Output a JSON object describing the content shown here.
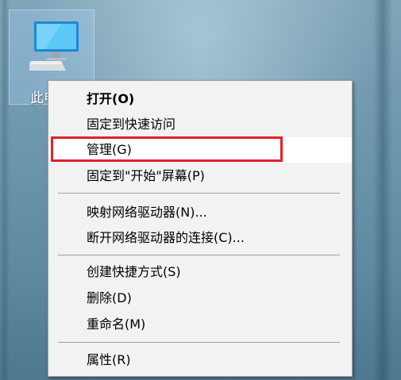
{
  "desktop": {
    "icon_label": "此电"
  },
  "context_menu": {
    "items": [
      {
        "label": "打开(O)"
      },
      {
        "label": "固定到快速访问"
      },
      {
        "label": "管理(G)"
      },
      {
        "label": "固定到\"开始\"屏幕(P)"
      },
      {
        "label": "映射网络驱动器(N)..."
      },
      {
        "label": "断开网络驱动器的连接(C)..."
      },
      {
        "label": "创建快捷方式(S)"
      },
      {
        "label": "删除(D)"
      },
      {
        "label": "重命名(M)"
      },
      {
        "label": "属性(R)"
      }
    ]
  },
  "colors": {
    "highlight_border": "#e0202a",
    "menu_background": "#f2f2f2"
  },
  "icons": {
    "desktop_icon": "this-pc-icon"
  }
}
